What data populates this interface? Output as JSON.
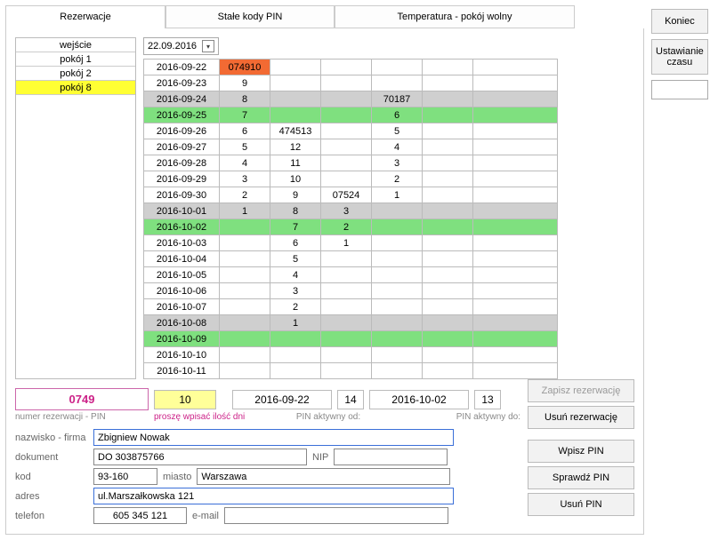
{
  "tabs": [
    "Rezerwacje",
    "Stałe kody PIN",
    "Temperatura - pokój wolny"
  ],
  "right_buttons": {
    "end": "Koniec",
    "set_time": "Ustawianie czasu"
  },
  "rooms": [
    {
      "label": "wejście",
      "selected": false
    },
    {
      "label": "pokój 1",
      "selected": false
    },
    {
      "label": "pokój 2",
      "selected": false
    },
    {
      "label": "pokój 8",
      "selected": true
    }
  ],
  "date_picker": "22.09.2016",
  "schedule": [
    {
      "cls": "",
      "c": [
        "2016-09-22",
        "074910",
        "",
        "",
        "",
        "",
        ""
      ],
      "orange": 1
    },
    {
      "cls": "",
      "c": [
        "2016-09-23",
        "9",
        "",
        "",
        "",
        "",
        ""
      ]
    },
    {
      "cls": "row-gray",
      "c": [
        "2016-09-24",
        "8",
        "",
        "",
        "70187",
        "",
        ""
      ]
    },
    {
      "cls": "row-green",
      "c": [
        "2016-09-25",
        "7",
        "",
        "",
        "6",
        "",
        ""
      ]
    },
    {
      "cls": "",
      "c": [
        "2016-09-26",
        "6",
        "474513",
        "",
        "5",
        "",
        ""
      ]
    },
    {
      "cls": "",
      "c": [
        "2016-09-27",
        "5",
        "12",
        "",
        "4",
        "",
        ""
      ]
    },
    {
      "cls": "",
      "c": [
        "2016-09-28",
        "4",
        "11",
        "",
        "3",
        "",
        ""
      ]
    },
    {
      "cls": "",
      "c": [
        "2016-09-29",
        "3",
        "10",
        "",
        "2",
        "",
        ""
      ]
    },
    {
      "cls": "",
      "c": [
        "2016-09-30",
        "2",
        "9",
        "07524",
        "1",
        "",
        ""
      ]
    },
    {
      "cls": "row-gray",
      "c": [
        "2016-10-01",
        "1",
        "8",
        "3",
        "",
        "",
        ""
      ]
    },
    {
      "cls": "row-green",
      "c": [
        "2016-10-02",
        "",
        "7",
        "2",
        "",
        "",
        ""
      ]
    },
    {
      "cls": "",
      "c": [
        "2016-10-03",
        "",
        "6",
        "1",
        "",
        "",
        ""
      ]
    },
    {
      "cls": "",
      "c": [
        "2016-10-04",
        "",
        "5",
        "",
        "",
        "",
        ""
      ]
    },
    {
      "cls": "",
      "c": [
        "2016-10-05",
        "",
        "4",
        "",
        "",
        "",
        ""
      ]
    },
    {
      "cls": "",
      "c": [
        "2016-10-06",
        "",
        "3",
        "",
        "",
        "",
        ""
      ]
    },
    {
      "cls": "",
      "c": [
        "2016-10-07",
        "",
        "2",
        "",
        "",
        "",
        ""
      ]
    },
    {
      "cls": "row-gray",
      "c": [
        "2016-10-08",
        "",
        "1",
        "",
        "",
        "",
        ""
      ]
    },
    {
      "cls": "row-green",
      "c": [
        "2016-10-09",
        "",
        "",
        "",
        "",
        "",
        ""
      ]
    },
    {
      "cls": "",
      "c": [
        "2016-10-10",
        "",
        "",
        "",
        "",
        "",
        ""
      ]
    },
    {
      "cls": "",
      "c": [
        "2016-10-11",
        "",
        "",
        "",
        "",
        "",
        ""
      ]
    }
  ],
  "mid": {
    "pin": "0749",
    "days": "10",
    "date_from": "2016-09-22",
    "n1": "14",
    "date_to": "2016-10-02",
    "n2": "13"
  },
  "sub_labels": {
    "l1": "numer rezerwacji - PIN",
    "l2": "proszę wpisać ilość dni",
    "l3": "PIN aktywny od:",
    "l4": "PIN aktywny do:"
  },
  "form_labels": {
    "name": "nazwisko - firma",
    "doc": "dokument",
    "nip": "NIP",
    "kod": "kod",
    "miasto": "miasto",
    "adres": "adres",
    "telefon": "telefon",
    "email": "e-mail"
  },
  "form_values": {
    "name": "Zbigniew Nowak",
    "doc": "DO 303875766",
    "nip": "",
    "kod": "93-160",
    "miasto": "Warszawa",
    "adres": "ul.Marszałkowska 121",
    "telefon": "605 345 121",
    "email": ""
  },
  "actions": {
    "save": "Zapisz rezerwację",
    "del": "Usuń rezerwację",
    "wpin": "Wpisz PIN",
    "spin": "Sprawdź PIN",
    "upin": "Usuń PIN"
  }
}
